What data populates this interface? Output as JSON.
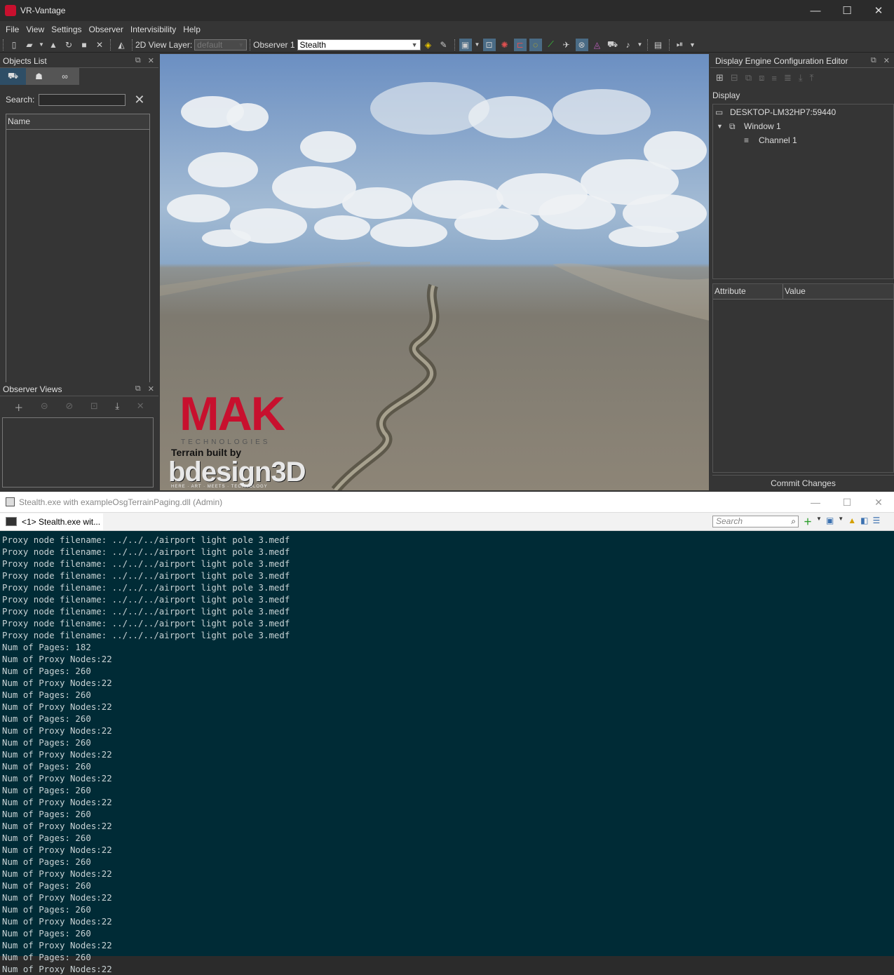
{
  "app": {
    "title": "VR-Vantage",
    "window_controls": [
      "—",
      "☐",
      "✕"
    ]
  },
  "menu": [
    "File",
    "View",
    "Settings",
    "Observer",
    "Intervisibility",
    "Help"
  ],
  "toolbar": {
    "view_layer_label": "2D View Layer:",
    "view_layer_value": "default",
    "observer_label": "Observer 1",
    "observer_value": "Stealth"
  },
  "objects_list": {
    "title": "Objects List",
    "search_label": "Search:",
    "search_value": "",
    "column_name": "Name"
  },
  "observer_views": {
    "title": "Observer Views"
  },
  "viewport": {
    "logo_text": "MAK",
    "logo_sub": "TECHNOLOGIES",
    "terrain_credit": "Terrain built by",
    "bdesign": "bdesign3D",
    "bdesign_sub": "HERE · ART · MEETS · TECHNOLOGY"
  },
  "dece": {
    "title": "Display Engine Configuration Editor",
    "display_label": "Display",
    "tree": {
      "host": "DESKTOP-LM32HP7:59440",
      "window": "Window 1",
      "channel": "Channel 1"
    },
    "col_attribute": "Attribute",
    "col_value": "Value",
    "commit_label": "Commit Changes"
  },
  "console": {
    "title": "Stealth.exe with exampleOsgTerrainPaging.dll (Admin)",
    "tab_label": "<1> Stealth.exe wit...",
    "search_placeholder": "Search",
    "lines": [
      "Proxy node filename: ../../../airport light pole 3.medf",
      "Proxy node filename: ../../../airport light pole 3.medf",
      "Proxy node filename: ../../../airport light pole 3.medf",
      "Proxy node filename: ../../../airport light pole 3.medf",
      "Proxy node filename: ../../../airport light pole 3.medf",
      "Proxy node filename: ../../../airport light pole 3.medf",
      "Proxy node filename: ../../../airport light pole 3.medf",
      "Proxy node filename: ../../../airport light pole 3.medf",
      "Proxy node filename: ../../../airport light pole 3.medf",
      "Num of Pages: 182",
      "Num of Proxy Nodes:22",
      "Num of Pages: 260",
      "Num of Proxy Nodes:22",
      "Num of Pages: 260",
      "Num of Proxy Nodes:22",
      "Num of Pages: 260",
      "Num of Proxy Nodes:22",
      "Num of Pages: 260",
      "Num of Proxy Nodes:22",
      "Num of Pages: 260",
      "Num of Proxy Nodes:22",
      "Num of Pages: 260",
      "Num of Proxy Nodes:22",
      "Num of Pages: 260",
      "Num of Proxy Nodes:22",
      "Num of Pages: 260",
      "Num of Proxy Nodes:22",
      "Num of Pages: 260",
      "Num of Proxy Nodes:22",
      "Num of Pages: 260",
      "Num of Proxy Nodes:22",
      "Num of Pages: 260",
      "Num of Proxy Nodes:22",
      "Num of Pages: 260",
      "Num of Proxy Nodes:22",
      "Num of Pages: 260",
      "Num of Proxy Nodes:22"
    ]
  },
  "colors": {
    "console_bg": "#002b36",
    "brand_red": "#c8102e",
    "tab_highlight": "#2e4e66"
  }
}
